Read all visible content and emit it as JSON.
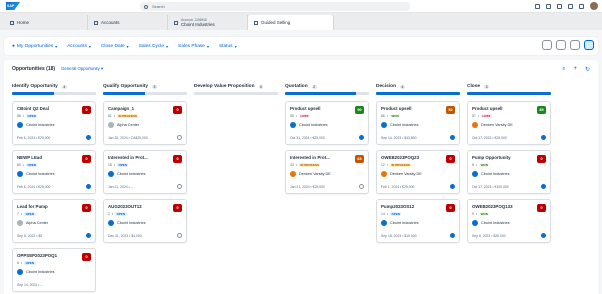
{
  "shell": {
    "logo": "SAP",
    "search_placeholder": "Search"
  },
  "tabs": [
    {
      "label": "Home",
      "sub": ""
    },
    {
      "label": "Accounts",
      "sub": ""
    },
    {
      "label": "Account: 1306948",
      "sub": "Cboint Industries"
    },
    {
      "label": "Guided Selling",
      "sub": ""
    }
  ],
  "filters": [
    "My Opportunities",
    "Accounts",
    "Close Date",
    "Sales Cycle",
    "Sales Phase",
    "Status"
  ],
  "board": {
    "title": "Opportunities (18)",
    "variant": "General Opportunity"
  },
  "colors": {
    "red": "#bb0000",
    "orange": "#c35500",
    "green": "#188918",
    "blue": "#0a6ed1"
  },
  "columns": [
    {
      "title": "Identify Opportunity",
      "count": "4",
      "progress": 0.5,
      "cards": [
        {
          "title": "CBoint Q2 Deal",
          "id": "86",
          "status": "OPEN",
          "status_type": "open",
          "account": "Cboint Industries",
          "logo": "blue",
          "date": "Feb 6, 2024 • €25,000",
          "score": "0",
          "score_color": "red",
          "check": "blue"
        },
        {
          "title": "NEWP LEad",
          "id": "80",
          "status": "OPEN",
          "status_type": "open",
          "account": "Cboint Industries",
          "logo": "blue",
          "date": "Feb 6, 2024 • €25,000",
          "score": "0",
          "score_color": "red",
          "check": "blue"
        },
        {
          "title": "Lead for Pump",
          "id": "7",
          "status": "OPEN",
          "status_type": "open",
          "account": "Alpha Center",
          "logo": "grey",
          "date": "Sep 6, 2023 • $0",
          "score": "0",
          "score_color": "red",
          "check": "blue"
        },
        {
          "title": "OPPSEP2023POQ1",
          "id": "6",
          "status": "OPEN",
          "status_type": "open",
          "account": "Cboint Industries",
          "logo": "blue",
          "date": "Sep 14, 2023 • --",
          "score": "0",
          "score_color": "red",
          "check": "none"
        }
      ]
    },
    {
      "title": "Qualify Opportunity",
      "count": "3",
      "progress": 0.5,
      "cards": [
        {
          "title": "Campaign_1",
          "id": "81",
          "status": "IN PROCESS",
          "status_type": "prog",
          "account": "Alpha Center",
          "logo": "grey",
          "date": "Jan 26, 2024 • CA$25,000",
          "score": "0",
          "score_color": "red",
          "check": "grey"
        },
        {
          "title": "Interested in Prot...",
          "id": "18",
          "status": "OPEN",
          "status_type": "open",
          "account": "Cboint Industries",
          "logo": "blue",
          "date": "Jan 21, 2024 • --",
          "score": "0",
          "score_color": "red",
          "check": "grey"
        },
        {
          "title": "AUG2023OUT12",
          "id": "2",
          "status": "OPEN",
          "status_type": "open",
          "account": "Cboint Industries",
          "logo": "blue",
          "date": "Dec 31, 2023 • $4,000",
          "score": "0",
          "score_color": "red",
          "check": "grey"
        }
      ]
    },
    {
      "title": "Develop Value Proposition",
      "count": "0",
      "progress": 0,
      "cards": []
    },
    {
      "title": "Quotation",
      "count": "2",
      "progress": 0.85,
      "cards": [
        {
          "title": "Product upsell",
          "id": "55",
          "status": "LOST",
          "status_type": "lost",
          "account": "Cboint Industries",
          "logo": "blue",
          "date": "Oct 31, 2024 • €25,000",
          "score": "90",
          "score_color": "green",
          "check": "blue"
        },
        {
          "title": "Interested in Prot...",
          "id": "43",
          "status": "IN PROCESS",
          "status_type": "prog",
          "account": "Denken Varsity DE",
          "logo": "orange",
          "date": "Jan 21, 2024 • €25,000",
          "score": "63",
          "score_color": "orange",
          "check": "grey"
        }
      ]
    },
    {
      "title": "Decision",
      "count": "4",
      "progress": 1,
      "cards": [
        {
          "title": "Product upsell",
          "id": "86",
          "status": "WON",
          "status_type": "won",
          "account": "Cboint Industries",
          "logo": "blue",
          "date": "Sep 14, 2023 • $43,800",
          "score": "52",
          "score_color": "orange",
          "check": "blue"
        },
        {
          "title": "OWEB2023POQ23",
          "id": "12",
          "status": "IN PROCESS",
          "status_type": "prog",
          "account": "Denken Varsity DE",
          "logo": "orange",
          "date": "Feb 1, 2024 • €25,000",
          "score": "0",
          "score_color": "red",
          "check": "blue"
        },
        {
          "title": "Pump2023OS12",
          "id": "14",
          "status": "OPEN",
          "status_type": "open",
          "account": "Cboint Industries",
          "logo": "blue",
          "date": "Sep 18, 2023 • $10,000",
          "score": "0",
          "score_color": "red",
          "check": "blue"
        }
      ]
    },
    {
      "title": "Close",
      "count": "3",
      "progress": 1,
      "cards": [
        {
          "title": "Product upsell",
          "id": "57",
          "status": "LOST",
          "status_type": "lost",
          "account": "Denken Varsity DE",
          "logo": "orange",
          "date": "Oct 17, 2023 • €25,000",
          "score": "85",
          "score_color": "green",
          "check": "blue"
        },
        {
          "title": "Pump Opportunity",
          "id": "8",
          "status": "WON",
          "status_type": "won",
          "account": "Cboint Industries",
          "logo": "blue",
          "date": "Oct 17, 2023 • €100,000",
          "score": "0",
          "score_color": "red",
          "check": "blue"
        },
        {
          "title": "OWEB2023POQ133",
          "id": "9",
          "status": "WON",
          "status_type": "won",
          "account": "Cboint Industries",
          "logo": "blue",
          "date": "Sep 8, 2023 • $25,000",
          "score": "0",
          "score_color": "red",
          "check": "blue"
        }
      ]
    }
  ]
}
